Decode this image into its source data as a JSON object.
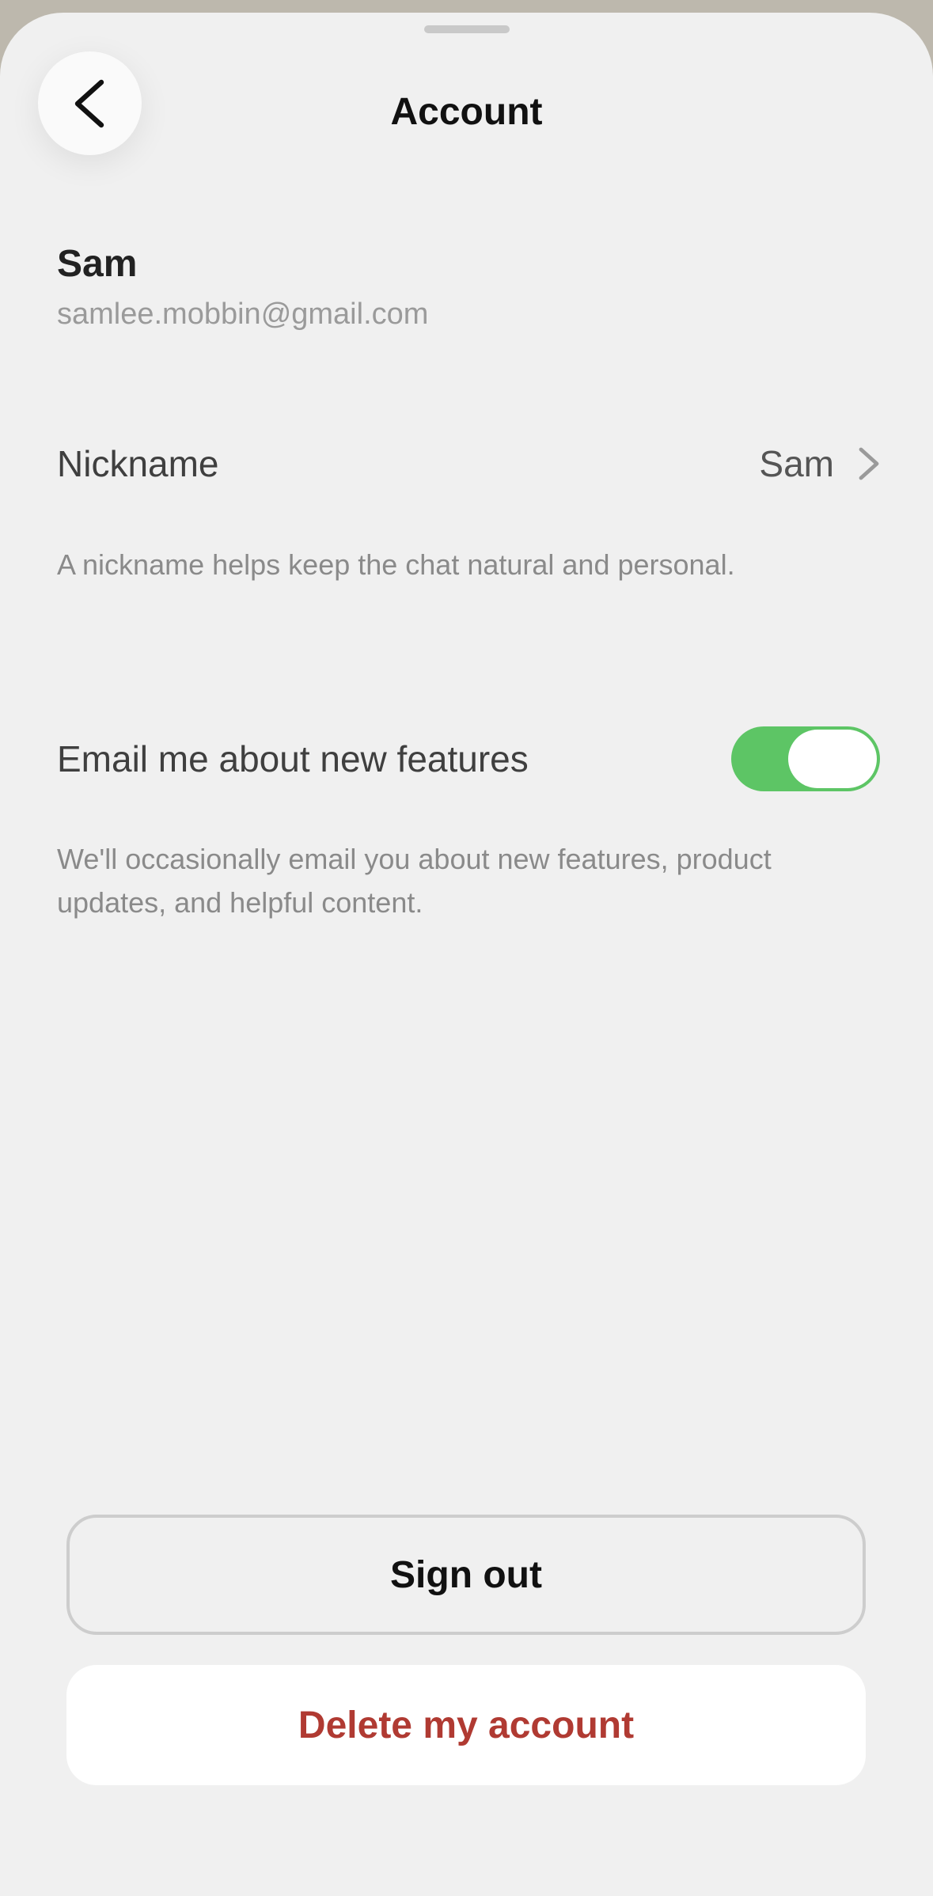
{
  "header": {
    "title": "Account",
    "back_icon": "chevron-left-icon"
  },
  "user": {
    "name": "Sam",
    "email": "samlee.mobbin@gmail.com"
  },
  "nickname": {
    "label": "Nickname",
    "value": "Sam",
    "helper": "A nickname helps keep the chat natural and personal.",
    "icon": "chevron-right-icon"
  },
  "email_updates": {
    "label": "Email me about new features",
    "enabled": true,
    "helper": "We'll occasionally email you about new features, product updates, and helpful content."
  },
  "actions": {
    "sign_out": "Sign out",
    "delete_account": "Delete my account"
  },
  "colors": {
    "toggle_on": "#5dc565",
    "danger": "#b03a32",
    "background": "#f0f0f0"
  }
}
